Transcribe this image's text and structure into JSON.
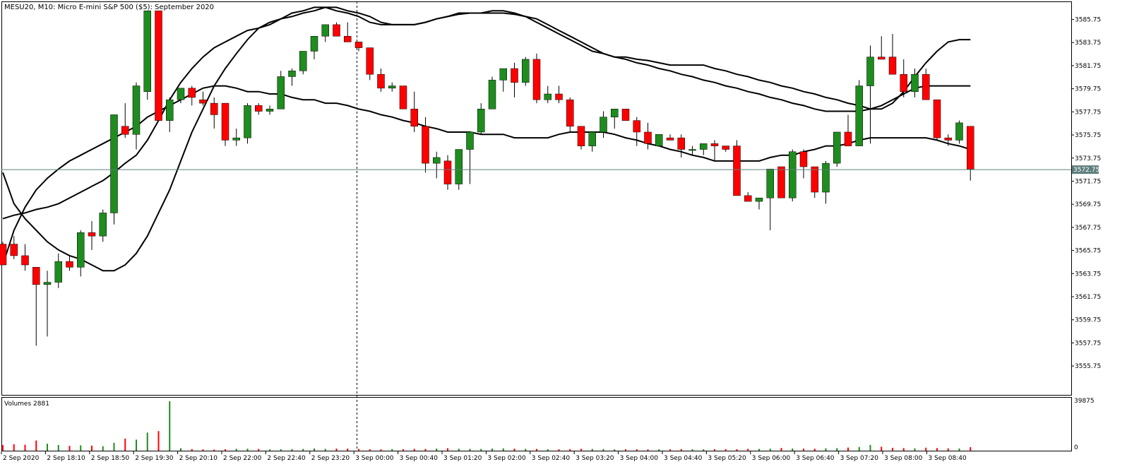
{
  "header": {
    "title": "MESU20, M10:  Micro E-mini S&P 500 ($5): September 2020"
  },
  "volume_panel": {
    "label": "Volumes 2881",
    "max_label": "39875",
    "zero_label": "0"
  },
  "current_price": {
    "label": "3572.75",
    "value": 3572.75,
    "color": "#5f7f7f"
  },
  "colors": {
    "bull": "#1e8c1e",
    "bear": "#ff0000",
    "band": "#000000",
    "background": "#ffffff"
  },
  "chart_data": {
    "type": "candlestick",
    "title": "MESU20, M10:  Micro E-mini S&P 500 ($5): September 2020",
    "ylim": [
      3553.25,
      3587.25
    ],
    "y_ticks": [
      "3585.75",
      "3583.75",
      "3581.75",
      "3579.75",
      "3577.75",
      "3575.75",
      "3573.75",
      "3571.75",
      "3569.75",
      "3567.75",
      "3565.75",
      "3563.75",
      "3561.75",
      "3559.75",
      "3557.75",
      "3555.75"
    ],
    "x_ticks": [
      "2 Sep 2020",
      "2 Sep 18:10",
      "2 Sep 18:50",
      "2 Sep 19:30",
      "2 Sep 20:10",
      "2 Sep 22:00",
      "2 Sep 22:40",
      "2 Sep 23:20",
      "3 Sep 00:00",
      "3 Sep 00:40",
      "3 Sep 01:20",
      "3 Sep 02:00",
      "3 Sep 02:40",
      "3 Sep 03:20",
      "3 Sep 04:00",
      "3 Sep 04:40",
      "3 Sep 05:20",
      "3 Sep 06:00",
      "3 Sep 06:40",
      "3 Sep 07:20",
      "3 Sep 08:00",
      "3 Sep 08:40"
    ],
    "candles": [
      [
        3566.3,
        3566.5,
        3564.5,
        3564.5
      ],
      [
        3566.3,
        3567.0,
        3565.0,
        3565.3
      ],
      [
        3565.3,
        3566.3,
        3564.0,
        3564.5
      ],
      [
        3564.3,
        3564.3,
        3557.5,
        3562.8
      ],
      [
        3562.8,
        3564.0,
        3558.3,
        3563.0
      ],
      [
        3563.0,
        3565.5,
        3562.5,
        3564.8
      ],
      [
        3564.8,
        3565.3,
        3564.0,
        3564.3
      ],
      [
        3564.3,
        3567.5,
        3563.5,
        3567.3
      ],
      [
        3567.3,
        3568.3,
        3565.8,
        3567.0
      ],
      [
        3567.0,
        3569.3,
        3566.5,
        3569.0
      ],
      [
        3569.0,
        3577.5,
        3568.0,
        3577.5
      ],
      [
        3576.5,
        3578.5,
        3575.5,
        3575.8
      ],
      [
        3575.8,
        3580.3,
        3574.5,
        3580.0
      ],
      [
        3579.5,
        3586.5,
        3578.8,
        3586.5
      ],
      [
        3586.5,
        3586.5,
        3577.0,
        3577.0
      ],
      [
        3577.0,
        3579.0,
        3576.0,
        3578.8
      ],
      [
        3578.8,
        3579.8,
        3578.5,
        3579.8
      ],
      [
        3579.8,
        3580.0,
        3578.3,
        3579.0
      ],
      [
        3578.8,
        3579.5,
        3578.3,
        3578.5
      ],
      [
        3578.5,
        3579.0,
        3576.3,
        3577.5
      ],
      [
        3578.5,
        3578.5,
        3574.8,
        3575.3
      ],
      [
        3575.3,
        3576.3,
        3574.8,
        3575.5
      ],
      [
        3575.5,
        3578.5,
        3575.0,
        3578.3
      ],
      [
        3578.3,
        3578.5,
        3577.5,
        3577.8
      ],
      [
        3577.8,
        3578.3,
        3577.5,
        3578.0
      ],
      [
        3578.0,
        3581.3,
        3578.0,
        3580.8
      ],
      [
        3580.8,
        3581.5,
        3580.0,
        3581.3
      ],
      [
        3581.3,
        3583.0,
        3581.0,
        3583.0
      ],
      [
        3583.0,
        3584.3,
        3582.3,
        3584.3
      ],
      [
        3584.3,
        3585.3,
        3583.8,
        3585.3
      ],
      [
        3585.3,
        3585.5,
        3584.5,
        3584.3
      ],
      [
        3584.3,
        3585.5,
        3583.8,
        3583.8
      ],
      [
        3583.8,
        3583.8,
        3583.0,
        3583.3
      ],
      [
        3583.3,
        3583.3,
        3580.5,
        3581.0
      ],
      [
        3581.0,
        3581.5,
        3579.5,
        3579.8
      ],
      [
        3579.8,
        3580.3,
        3579.5,
        3580.0
      ],
      [
        3580.0,
        3580.0,
        3578.0,
        3578.0
      ],
      [
        3578.0,
        3579.5,
        3576.0,
        3576.5
      ],
      [
        3576.5,
        3577.3,
        3572.5,
        3573.3
      ],
      [
        3573.3,
        3574.3,
        3572.0,
        3573.8
      ],
      [
        3573.5,
        3574.0,
        3571.0,
        3571.5
      ],
      [
        3571.5,
        3574.5,
        3571.0,
        3574.5
      ],
      [
        3574.5,
        3575.8,
        3571.5,
        3576.0
      ],
      [
        3576.0,
        3578.5,
        3575.8,
        3578.0
      ],
      [
        3578.0,
        3580.8,
        3578.0,
        3580.5
      ],
      [
        3580.5,
        3581.5,
        3579.5,
        3581.5
      ],
      [
        3581.5,
        3582.0,
        3579.0,
        3580.3
      ],
      [
        3580.3,
        3582.5,
        3580.0,
        3582.3
      ],
      [
        3582.3,
        3582.8,
        3578.5,
        3578.8
      ],
      [
        3578.8,
        3580.0,
        3578.5,
        3579.3
      ],
      [
        3579.3,
        3580.0,
        3578.5,
        3578.8
      ],
      [
        3578.8,
        3579.0,
        3576.0,
        3576.5
      ],
      [
        3576.5,
        3576.5,
        3574.5,
        3574.8
      ],
      [
        3574.8,
        3576.0,
        3574.3,
        3576.0
      ],
      [
        3576.0,
        3577.8,
        3575.5,
        3577.3
      ],
      [
        3577.3,
        3578.0,
        3576.3,
        3578.0
      ],
      [
        3578.0,
        3578.0,
        3577.0,
        3577.0
      ],
      [
        3577.0,
        3577.3,
        3574.8,
        3576.0
      ],
      [
        3576.0,
        3576.8,
        3574.5,
        3575.0
      ],
      [
        3574.8,
        3575.5,
        3574.8,
        3575.8
      ],
      [
        3575.5,
        3575.8,
        3575.3,
        3575.3
      ],
      [
        3575.5,
        3575.8,
        3573.8,
        3574.5
      ],
      [
        3574.5,
        3574.8,
        3574.0,
        3574.5
      ],
      [
        3574.5,
        3575.0,
        3574.0,
        3575.0
      ],
      [
        3575.0,
        3575.3,
        3573.5,
        3574.8
      ],
      [
        3574.8,
        3574.8,
        3574.3,
        3574.5
      ],
      [
        3574.8,
        3575.3,
        3571.8,
        3570.5
      ],
      [
        3570.5,
        3570.8,
        3570.0,
        3570.0
      ],
      [
        3570.0,
        3570.3,
        3569.3,
        3570.3
      ],
      [
        3570.3,
        3572.8,
        3567.5,
        3572.8
      ],
      [
        3573.0,
        3573.0,
        3570.5,
        3570.3
      ],
      [
        3570.3,
        3574.5,
        3570.0,
        3574.3
      ],
      [
        3574.3,
        3574.5,
        3572.0,
        3573.0
      ],
      [
        3573.0,
        3573.0,
        3570.3,
        3570.8
      ],
      [
        3570.8,
        3573.5,
        3569.8,
        3573.3
      ],
      [
        3573.3,
        3576.0,
        3573.0,
        3576.0
      ],
      [
        3576.0,
        3577.5,
        3575.0,
        3574.8
      ],
      [
        3574.8,
        3580.5,
        3574.8,
        3580.0
      ],
      [
        3580.0,
        3583.5,
        3575.0,
        3582.5
      ],
      [
        3582.5,
        3584.3,
        3582.3,
        3582.3
      ],
      [
        3582.5,
        3584.5,
        3581.0,
        3581.0
      ],
      [
        3581.0,
        3582.3,
        3579.0,
        3579.5
      ],
      [
        3579.5,
        3581.5,
        3579.0,
        3581.0
      ],
      [
        3581.0,
        3581.5,
        3578.8,
        3578.8
      ],
      [
        3578.8,
        3578.8,
        3575.3,
        3575.5
      ],
      [
        3575.5,
        3575.8,
        3574.8,
        3575.3
      ],
      [
        3575.3,
        3577.0,
        3575.0,
        3576.8
      ],
      [
        3576.5,
        3576.5,
        3571.8,
        3572.8
      ]
    ],
    "volumes": [
      4500,
      5200,
      4800,
      8200,
      5600,
      4600,
      3900,
      4300,
      4100,
      3600,
      6300,
      9800,
      8900,
      14600,
      15800,
      39875,
      2000,
      1300,
      1100,
      900,
      1200,
      1500,
      1600,
      1400,
      1000,
      1200,
      1300,
      1400,
      1800,
      1500,
      1700,
      1700,
      1400,
      1200,
      1100,
      1300,
      1200,
      1500,
      1400,
      1700,
      2000,
      1600,
      1500,
      1400,
      1700,
      1900,
      1600,
      1500,
      1400,
      1200,
      1100,
      1300,
      1500,
      1400,
      1300,
      1100,
      1200,
      1100,
      1000,
      1200,
      1100,
      1300,
      1200,
      1100,
      1200,
      1200,
      1200,
      1500,
      1400,
      1600,
      2200,
      1800,
      1700,
      1600,
      1900,
      2100,
      2500,
      3000,
      4600,
      3200,
      2300,
      2100,
      1900,
      2400,
      2100,
      1900,
      1800,
      2881
    ],
    "bb_upper": [
      3572.5,
      3569.8,
      3568.5,
      3567.5,
      3566.5,
      3565.8,
      3565.3,
      3565.0,
      3564.5,
      3564.0,
      3564.0,
      3564.5,
      3565.5,
      3567.0,
      3569.0,
      3571.0,
      3573.5,
      3576.0,
      3578.0,
      3580.0,
      3581.5,
      3582.8,
      3584.0,
      3585.0,
      3585.5,
      3585.8,
      3586.3,
      3586.5,
      3586.8,
      3586.8,
      3586.5,
      3586.3,
      3586.0,
      3585.5,
      3585.3,
      3585.3,
      3585.3,
      3585.3,
      3585.5,
      3585.8,
      3586.0,
      3586.2,
      3586.3,
      3586.3,
      3586.3,
      3586.3,
      3586.2,
      3586.0,
      3585.5,
      3585.0,
      3584.5,
      3584.0,
      3583.5,
      3583.0,
      3582.8,
      3582.5,
      3582.5,
      3582.3,
      3582.2,
      3582.0,
      3581.8,
      3581.8,
      3581.8,
      3581.8,
      3581.5,
      3581.3,
      3581.0,
      3580.8,
      3580.5,
      3580.3,
      3580.0,
      3579.8,
      3579.5,
      3579.3,
      3579.0,
      3578.8,
      3578.5,
      3578.3,
      3578.0,
      3578.0,
      3578.5,
      3579.5,
      3580.8,
      3582.0,
      3583.0,
      3583.8,
      3584.0,
      3584.0
    ],
    "bb_middle": [
      3568.5,
      3568.8,
      3569.0,
      3569.3,
      3569.5,
      3569.8,
      3570.3,
      3570.8,
      3571.3,
      3571.8,
      3572.5,
      3573.3,
      3574.0,
      3575.3,
      3577.0,
      3578.8,
      3580.3,
      3581.5,
      3582.5,
      3583.3,
      3583.8,
      3584.3,
      3584.8,
      3585.0,
      3585.3,
      3585.8,
      3586.0,
      3586.3,
      3586.5,
      3586.8,
      3586.8,
      3586.5,
      3586.3,
      3586.0,
      3585.5,
      3585.3,
      3585.3,
      3585.3,
      3585.5,
      3585.8,
      3586.0,
      3586.3,
      3586.3,
      3586.3,
      3586.5,
      3586.5,
      3586.3,
      3586.0,
      3585.8,
      3585.3,
      3584.8,
      3584.3,
      3583.8,
      3583.3,
      3582.8,
      3582.5,
      3582.3,
      3582.0,
      3581.8,
      3581.5,
      3581.3,
      3581.0,
      3580.8,
      3580.5,
      3580.3,
      3580.0,
      3579.8,
      3579.5,
      3579.3,
      3579.0,
      3578.8,
      3578.5,
      3578.3,
      3578.0,
      3577.8,
      3577.8,
      3577.8,
      3577.8,
      3578.0,
      3578.3,
      3578.8,
      3579.3,
      3579.8,
      3580.0,
      3580.0,
      3580.0,
      3580.0,
      3580.0
    ],
    "bb_lower": [
      3564.5,
      3567.5,
      3569.5,
      3571.0,
      3572.0,
      3572.8,
      3573.5,
      3574.0,
      3574.5,
      3575.0,
      3575.5,
      3576.0,
      3576.5,
      3577.3,
      3577.8,
      3578.3,
      3578.8,
      3579.3,
      3579.8,
      3580.0,
      3580.0,
      3579.8,
      3579.5,
      3579.5,
      3579.3,
      3579.3,
      3579.0,
      3578.8,
      3578.8,
      3578.5,
      3578.5,
      3578.3,
      3578.0,
      3577.8,
      3577.5,
      3577.3,
      3577.0,
      3576.8,
      3576.5,
      3576.3,
      3576.0,
      3576.0,
      3576.0,
      3575.8,
      3575.8,
      3575.8,
      3575.5,
      3575.5,
      3575.5,
      3575.5,
      3575.8,
      3576.0,
      3576.0,
      3576.0,
      3576.0,
      3575.8,
      3575.5,
      3575.3,
      3575.0,
      3574.8,
      3574.5,
      3574.3,
      3574.0,
      3573.8,
      3573.5,
      3573.5,
      3573.5,
      3573.5,
      3573.5,
      3573.8,
      3574.0,
      3574.0,
      3574.3,
      3574.5,
      3574.8,
      3574.8,
      3575.0,
      3575.3,
      3575.5,
      3575.5,
      3575.5,
      3575.5,
      3575.5,
      3575.5,
      3575.3,
      3575.0,
      3574.8,
      3574.5
    ]
  }
}
